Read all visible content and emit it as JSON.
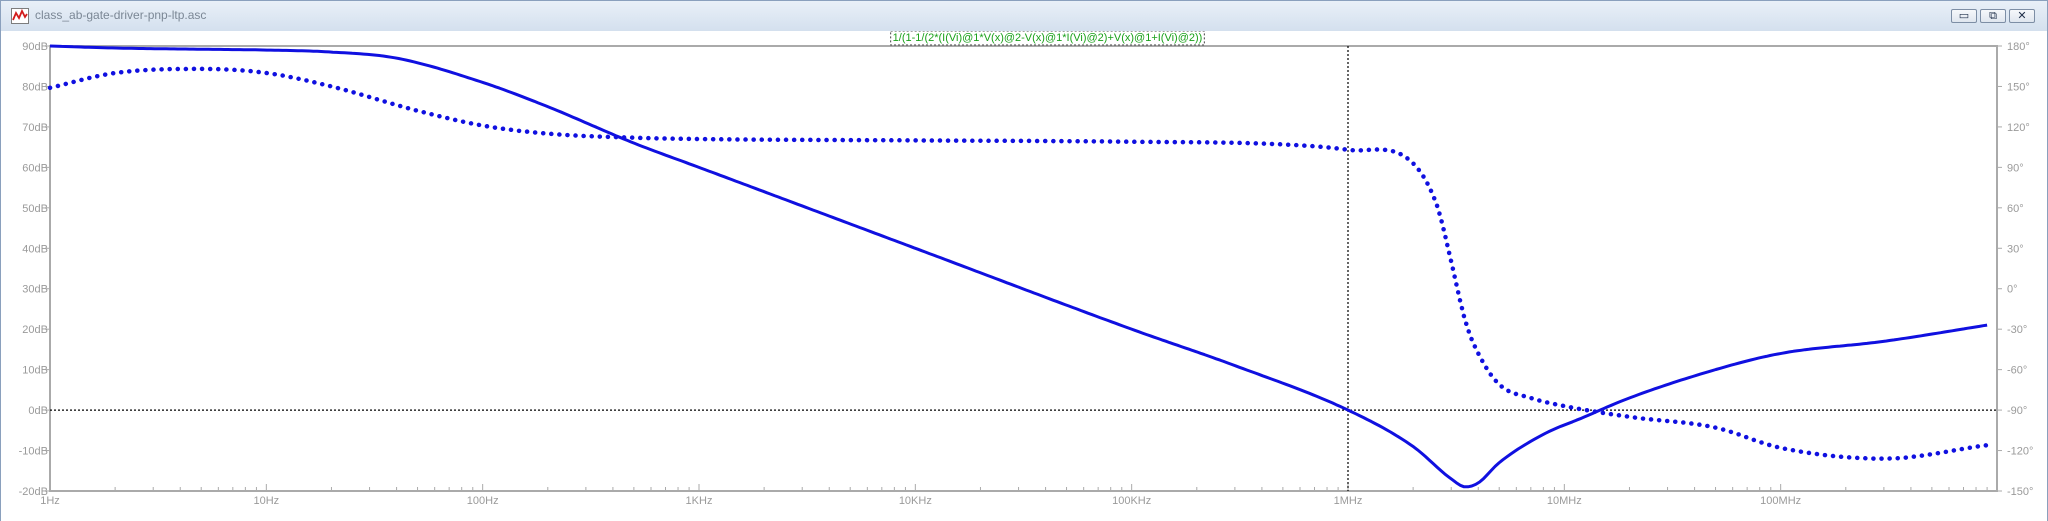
{
  "window": {
    "title": "class_ab-gate-driver-pnp-ltp.asc",
    "controls": {
      "minimize": "▭",
      "restore": "⧉",
      "close": "✕"
    }
  },
  "colors": {
    "trace": "#1010e0",
    "expression": "#1aa11a",
    "frame": "#aaaaaa",
    "axis_text": "#9a9a9a"
  },
  "chart_data": {
    "type": "line",
    "expression": "1/(1-1/(2*(I(Vi)@1*V(x)@2-V(x)@1*I(Vi)@2)+V(x)@1+I(Vi)@2))",
    "x_scale": "log",
    "xlim": [
      1,
      1000000000
    ],
    "ylim": [
      -20,
      90
    ],
    "y2lim": [
      -150,
      180
    ],
    "x_ticks": [
      {
        "v": 1,
        "label": "1Hz"
      },
      {
        "v": 10,
        "label": "10Hz"
      },
      {
        "v": 100,
        "label": "100Hz"
      },
      {
        "v": 1000,
        "label": "1KHz"
      },
      {
        "v": 10000,
        "label": "10KHz"
      },
      {
        "v": 100000,
        "label": "100KHz"
      },
      {
        "v": 1000000,
        "label": "1MHz"
      },
      {
        "v": 10000000,
        "label": "10MHz"
      },
      {
        "v": 100000000,
        "label": "100MHz"
      }
    ],
    "y_ticks": [
      {
        "v": 90,
        "label": "90dB"
      },
      {
        "v": 80,
        "label": "80dB"
      },
      {
        "v": 70,
        "label": "70dB"
      },
      {
        "v": 60,
        "label": "60dB"
      },
      {
        "v": 50,
        "label": "50dB"
      },
      {
        "v": 40,
        "label": "40dB"
      },
      {
        "v": 30,
        "label": "30dB"
      },
      {
        "v": 20,
        "label": "20dB"
      },
      {
        "v": 10,
        "label": "10dB"
      },
      {
        "v": 0,
        "label": "0dB"
      },
      {
        "v": -10,
        "label": "-10dB"
      },
      {
        "v": -20,
        "label": "-20dB"
      }
    ],
    "y2_ticks": [
      {
        "v": 180,
        "label": "180°"
      },
      {
        "v": 150,
        "label": "150°"
      },
      {
        "v": 120,
        "label": "120°"
      },
      {
        "v": 90,
        "label": "90°"
      },
      {
        "v": 60,
        "label": "60°"
      },
      {
        "v": 30,
        "label": "30°"
      },
      {
        "v": 0,
        "label": "0°"
      },
      {
        "v": -30,
        "label": "-30°"
      },
      {
        "v": -60,
        "label": "-60°"
      },
      {
        "v": -90,
        "label": "-90°"
      },
      {
        "v": -120,
        "label": "-120°"
      },
      {
        "v": -150,
        "label": "-150°"
      }
    ],
    "cursor": {
      "x": 1000000,
      "y_db": 0
    },
    "series": [
      {
        "kind": "magnitude",
        "unit": "dB",
        "style": "solid",
        "x": [
          1,
          2,
          5,
          10,
          20,
          40,
          100,
          200,
          500,
          1000,
          10000,
          100000,
          300000,
          1000000,
          2000000,
          3000000,
          3500000,
          4000000,
          5000000,
          8000000,
          12000000,
          20000000,
          50000000,
          100000000,
          300000000,
          900000000
        ],
        "values": [
          90,
          89.5,
          89.2,
          89,
          88.5,
          87,
          81,
          75,
          66,
          60,
          40,
          20,
          11,
          0,
          -9,
          -17,
          -19,
          -18,
          -13,
          -6,
          -2,
          3,
          10,
          14,
          17,
          21
        ]
      },
      {
        "kind": "phase",
        "unit": "deg",
        "style": "dotted",
        "x": [
          1,
          2,
          5,
          10,
          20,
          50,
          100,
          200,
          500,
          1000,
          10000,
          100000,
          500000,
          1000000,
          2000000,
          2600000,
          3000000,
          3500000,
          4000000,
          5000000,
          7000000,
          10000000,
          20000000,
          50000000,
          100000000,
          300000000,
          900000000
        ],
        "values": [
          149,
          160,
          163,
          160,
          150,
          132,
          121,
          115,
          112,
          111,
          110,
          109,
          107,
          103,
          93,
          60,
          20,
          -25,
          -48,
          -71,
          -81,
          -87,
          -95,
          -103,
          -118,
          -126,
          -116
        ]
      }
    ]
  }
}
